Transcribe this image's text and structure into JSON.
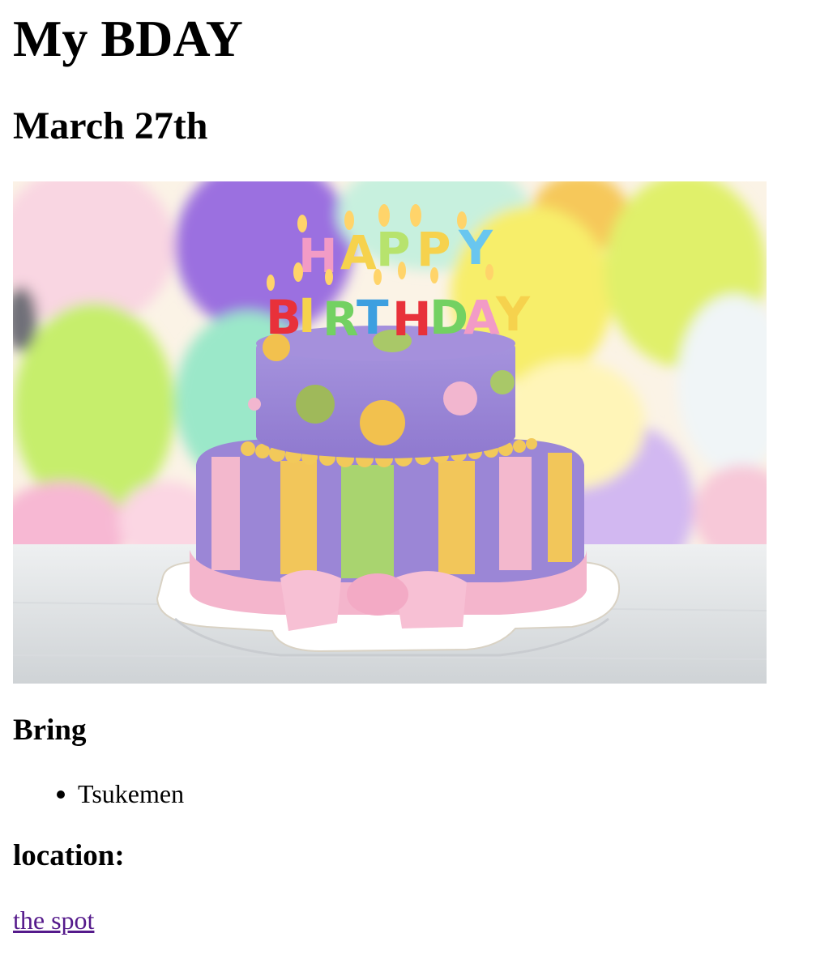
{
  "page": {
    "title": "My BDAY",
    "date": "March 27th"
  },
  "image": {
    "alt": "Happy Birthday cake",
    "candle_text_line1": "HAPPY",
    "candle_text_line2": "BIRTHDAY"
  },
  "bring": {
    "heading": "Bring",
    "items": [
      "Tsukemen"
    ]
  },
  "location": {
    "heading": "location:",
    "link_text": "the spot",
    "link_color": "#551a8b"
  },
  "colors": {
    "cake_purple": "#9b86d6",
    "cake_pink": "#f3b8cd",
    "cake_yellow": "#f2c65a",
    "cake_green": "#a9d46f"
  }
}
